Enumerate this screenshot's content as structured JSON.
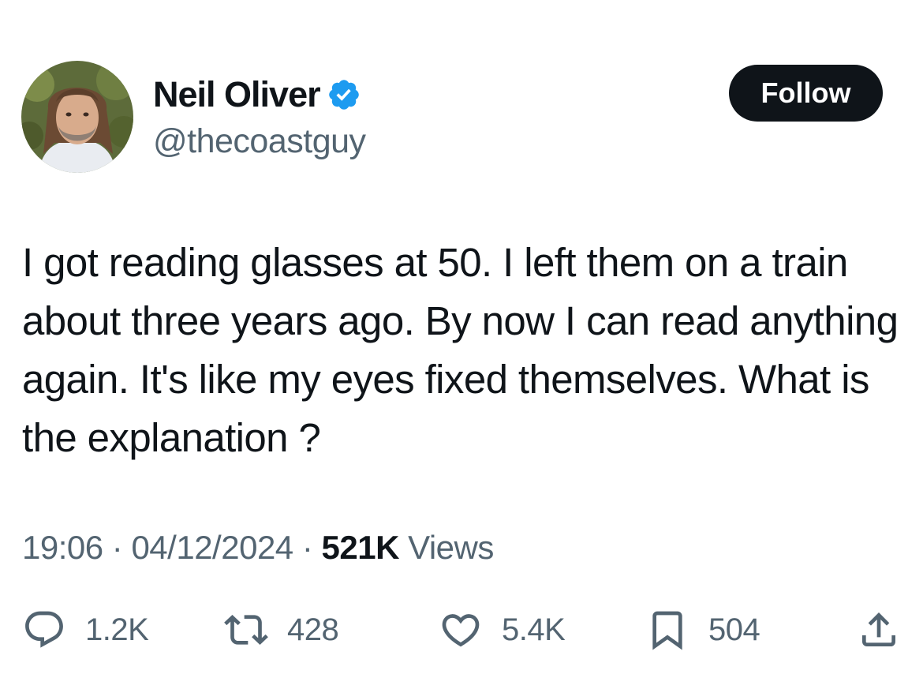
{
  "author": {
    "display_name": "Neil Oliver",
    "handle": "@thecoastguy",
    "avatar_icon": "avatar-photo",
    "verified_icon": "verified-badge-icon",
    "verified_color": "#1d9bf0"
  },
  "follow_button": {
    "label": "Follow"
  },
  "tweet": {
    "text": "I got reading glasses at 50. I left them on a train about three years ago. By now I can read anything again. It's like my eyes fixed themselves. What is the explanation ?"
  },
  "meta": {
    "time": "19:06",
    "separator": "·",
    "date": "04/12/2024",
    "views_count": "521K",
    "views_label": "Views"
  },
  "actions": {
    "replies": {
      "icon": "reply-icon",
      "count": "1.2K"
    },
    "reposts": {
      "icon": "repost-icon",
      "count": "428"
    },
    "likes": {
      "icon": "heart-icon",
      "count": "5.4K"
    },
    "bookmarks": {
      "icon": "bookmark-icon",
      "count": "504"
    },
    "share": {
      "icon": "share-icon"
    }
  },
  "colors": {
    "text_primary": "#0f1419",
    "text_secondary": "#536471",
    "follow_bg": "#0f1419",
    "follow_text": "#ffffff"
  }
}
